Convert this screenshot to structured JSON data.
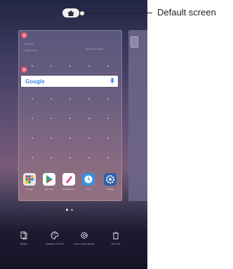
{
  "callout": {
    "label": "Default screen"
  },
  "widgets": {
    "time": "11:27 AM",
    "date": "WED, 3 OCT",
    "hint": "Tap to add weather"
  },
  "search": {
    "logo": "Google",
    "icon": "mic-icon"
  },
  "apps": [
    {
      "label": "Google",
      "icon": "google-folder-icon",
      "color": "#e7e4ef"
    },
    {
      "label": "Play Store",
      "icon": "play-store-icon",
      "color": "#ffffff"
    },
    {
      "label": "QuickMemo+",
      "icon": "quickmemo-icon",
      "color": "#ffffff"
    },
    {
      "label": "Clock",
      "icon": "clock-icon",
      "color": "#3a8fdc"
    },
    {
      "label": "Settings",
      "icon": "gear-icon",
      "color": "#2f5fae"
    }
  ],
  "toolbar": [
    {
      "label": "Widgets",
      "icon": "widgets-icon"
    },
    {
      "label": "Wallpaper & theme",
      "icon": "palette-icon"
    },
    {
      "label": "Home screen settings",
      "icon": "settings-gear-icon"
    },
    {
      "label": "App trash",
      "icon": "trash-icon"
    }
  ],
  "pages": {
    "count": 2,
    "current": 1
  }
}
